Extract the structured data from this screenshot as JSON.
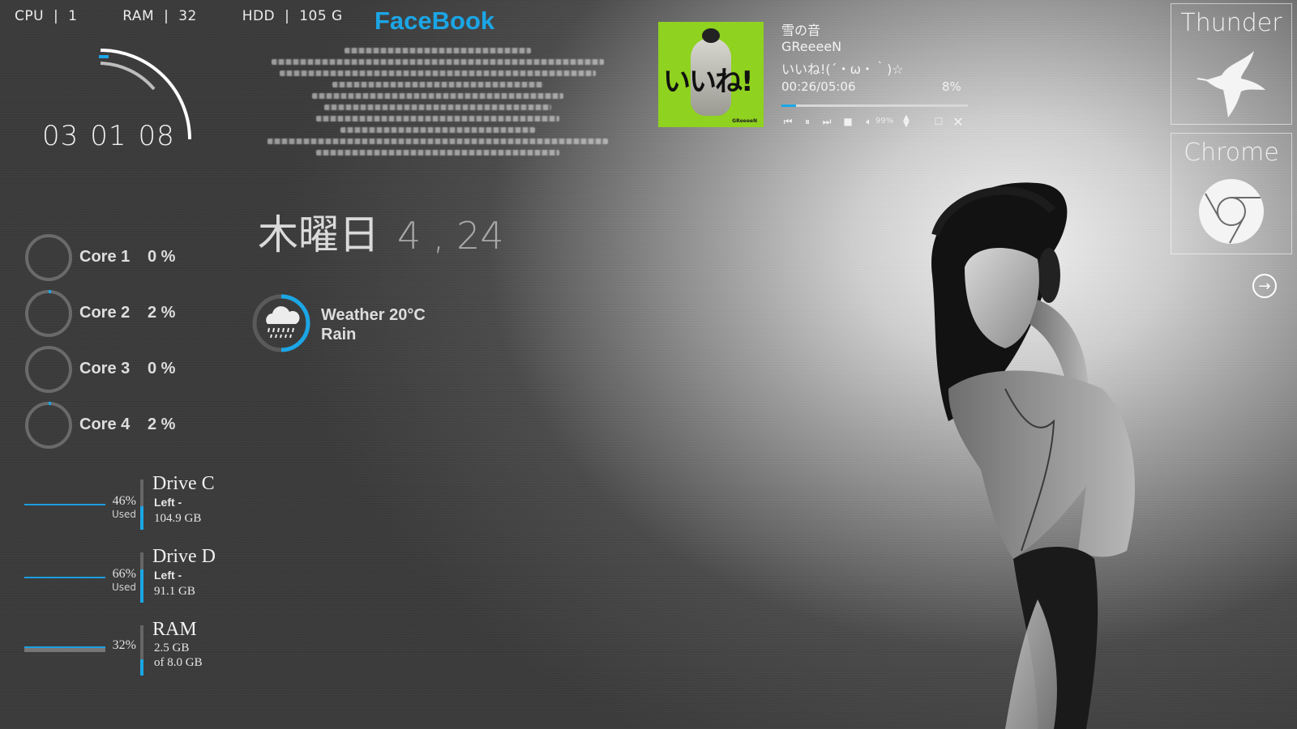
{
  "stats": {
    "cpu_label": "CPU",
    "cpu_value": "1",
    "ram_label": "RAM",
    "ram_value": "32",
    "hdd_label": "HDD",
    "hdd_value": "105 G",
    "sep": "|"
  },
  "clock": {
    "h": "03",
    "m": "01",
    "s": "08"
  },
  "facebook": {
    "title": "FaceBook"
  },
  "cores": [
    {
      "label": "Core 1",
      "value": "0 %",
      "load": 0
    },
    {
      "label": "Core 2",
      "value": "2 %",
      "load": 0.02
    },
    {
      "label": "Core 3",
      "value": "0 %",
      "load": 0
    },
    {
      "label": "Core 4",
      "value": "2 %",
      "load": 0.02
    }
  ],
  "drives": [
    {
      "name": "Drive C",
      "pct": "46%",
      "used": "Used",
      "line1": "Left -",
      "line2": "104.9 GB",
      "fill": 0.46
    },
    {
      "name": "Drive D",
      "pct": "66%",
      "used": "Used",
      "line1": "Left -",
      "line2": "91.1 GB",
      "fill": 0.66
    },
    {
      "name": "RAM",
      "pct": "32%",
      "used": "",
      "line1": "2.5 GB",
      "line2": "of 8.0 GB",
      "fill": 0.32
    }
  ],
  "date": {
    "weekday": "木曜日",
    "nums": "4 , 24"
  },
  "weather": {
    "line1": "Weather 20°C",
    "line2": "Rain",
    "icon": "rain-cloud-icon"
  },
  "player": {
    "song": "雪の音",
    "artist": "GReeeeN",
    "album": "いいね!(´・ω・｀)☆",
    "cover_text": "いいね!",
    "cover_small": "GReeeeN",
    "time": "00:26/05:06",
    "percent": "8%",
    "progress": 0.08,
    "volume": "99%",
    "accent": "#1ba6e6"
  },
  "launchers": {
    "thunder": "Thunder",
    "chrome": "Chrome"
  },
  "colors": {
    "accent": "#1ba6e6"
  }
}
